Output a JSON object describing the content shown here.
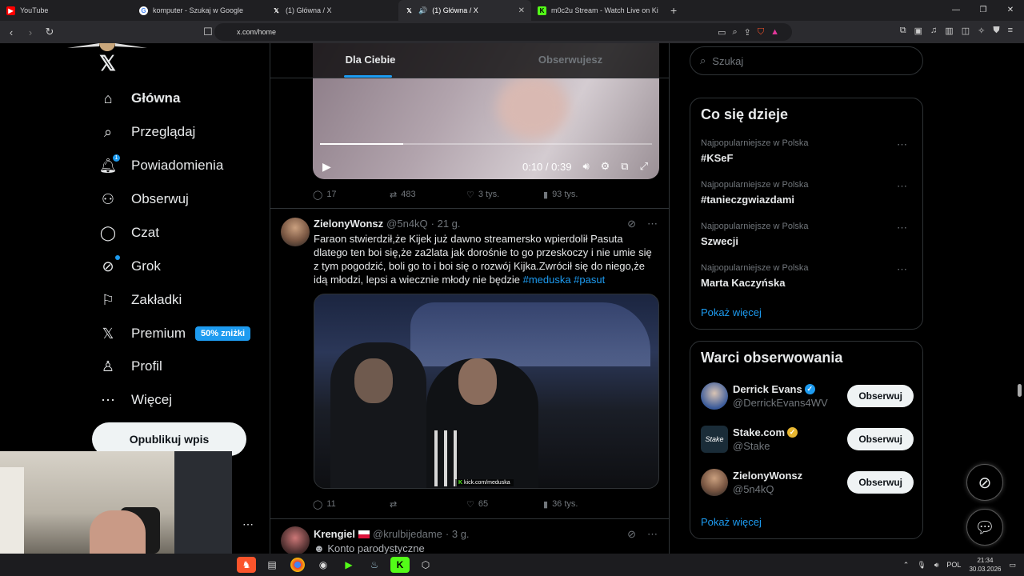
{
  "browser": {
    "tabs": [
      {
        "label": "YouTube",
        "icon": "youtube-icon",
        "color": "#ff0000",
        "active": false
      },
      {
        "label": "komputer - Szukaj w Google",
        "icon": "google-icon",
        "color": "#4285f4",
        "active": false
      },
      {
        "label": "(1) Główna / X",
        "icon": "x-icon",
        "color": "#000000",
        "active": false
      },
      {
        "label": "(1) Główna / X",
        "icon": "x-icon",
        "color": "#000000",
        "active": true
      },
      {
        "label": "m0c2u Stream - Watch Live on Ki",
        "icon": "kick-icon",
        "color": "#53fc18",
        "active": false
      }
    ],
    "url": "x.com/home"
  },
  "sidebar": {
    "items": [
      {
        "label": "Główna",
        "icon": "home-icon"
      },
      {
        "label": "Przeglądaj",
        "icon": "search-icon"
      },
      {
        "label": "Powiadomienia",
        "icon": "bell-icon",
        "badge": "1"
      },
      {
        "label": "Obserwuj",
        "icon": "follow-icon"
      },
      {
        "label": "Czat",
        "icon": "chat-icon"
      },
      {
        "label": "Grok",
        "icon": "grok-icon"
      },
      {
        "label": "Zakładki",
        "icon": "bookmark-icon"
      },
      {
        "label": "Premium",
        "icon": "x-icon",
        "badge_text": "50% zniżki"
      },
      {
        "label": "Profil",
        "icon": "profile-icon"
      },
      {
        "label": "Więcej",
        "icon": "more-icon"
      }
    ],
    "post_button": "Opublikuj wpis"
  },
  "feed": {
    "tabs": [
      "Dla Ciebie",
      "Obserwujesz"
    ],
    "video1": {
      "time": "0:10 / 0:39",
      "progress": 0.25
    },
    "tweet1_actions": {
      "replies": "17",
      "reposts": "483",
      "likes": "3 tys.",
      "views": "93 tys."
    },
    "tweet2": {
      "name": "ZielonyWonsz",
      "handle": "@5n4kQ",
      "time": "· 21 g.",
      "text": "Faraon stwierdził,że Kijek już dawno streamersko wpierdolił Pasuta dlatego ten boi się,że za2lata jak dorośnie to go przeskoczy i nie umie się z tym pogodzić, boli go to i boi się o rozwój Kijka.Zwrócił się do niego,że idą młodzi, lepsi a wiecznie młody nie będzie",
      "tags": "#meduska #pasut",
      "video_overlay": "kick.com/meduska",
      "replies": "11",
      "reposts": "",
      "likes": "65",
      "views": "36 tys."
    },
    "tweet3": {
      "name": "Krengiel",
      "handle": "@krulbijedame",
      "time": "· 3 g.",
      "subtitle": "Konto parodystyczne"
    }
  },
  "right": {
    "search_placeholder": "Szukaj",
    "trends_title": "Co się dzieje",
    "trends": [
      {
        "meta": "Najpopularniejsze w Polska",
        "title": "#KSeF"
      },
      {
        "meta": "Najpopularniejsze w Polska",
        "title": "#tanieczgwiazdami"
      },
      {
        "meta": "Najpopularniejsze w Polska",
        "title": "Szwecji"
      },
      {
        "meta": "Najpopularniejsze w Polska",
        "title": "Marta Kaczyńska"
      }
    ],
    "show_more": "Pokaż więcej",
    "who_title": "Warci obserwowania",
    "who": [
      {
        "name": "Derrick Evans",
        "handle": "@DerrickEvans4WV",
        "verified": "blue",
        "button": "Obserwuj"
      },
      {
        "name": "Stake.com",
        "handle": "@Stake",
        "verified": "gold",
        "button": "Obserwuj"
      },
      {
        "name": "ZielonyWonsz",
        "handle": "@5n4kQ",
        "verified": "",
        "button": "Obserwuj"
      }
    ],
    "show_more2": "Pokaż więcej"
  },
  "taskbar": {
    "lang": "POL",
    "time": "21:34",
    "date": "30.03.2026"
  },
  "colors": {
    "accent": "#1d9bf0",
    "background": "#000000",
    "border": "#2f3336"
  }
}
